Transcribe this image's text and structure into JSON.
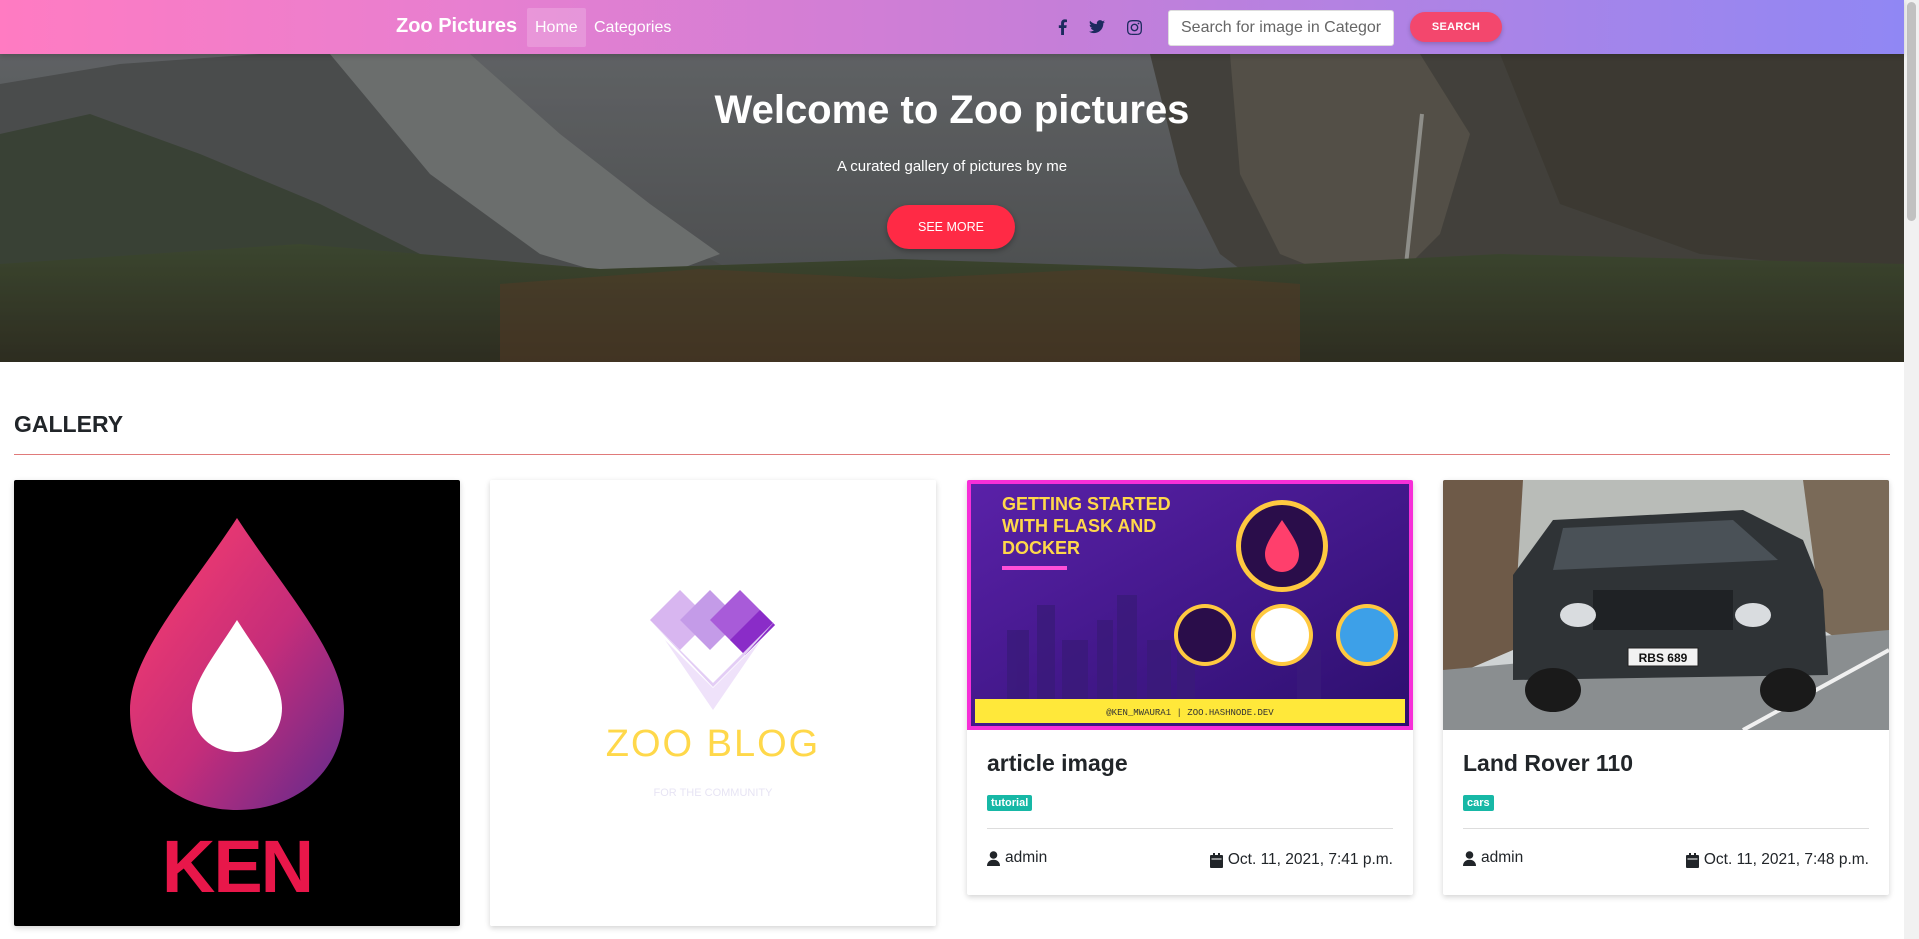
{
  "navbar": {
    "brand": "Zoo Pictures",
    "links": [
      {
        "label": "Home",
        "active": true
      },
      {
        "label": "Categories",
        "active": false
      }
    ],
    "social_icons": [
      "facebook-icon",
      "twitter-icon",
      "instagram-icon"
    ],
    "search": {
      "placeholder": "Search for image in Category",
      "button_label": "SEARCH"
    }
  },
  "hero": {
    "title": "Welcome to Zoo pictures",
    "subtitle": "A curated gallery of pictures by me",
    "button_label": "SEE MORE"
  },
  "gallery": {
    "heading": "GALLERY",
    "cards": [
      {
        "title": "",
        "tag": "",
        "author": "",
        "date": ""
      },
      {
        "title": "",
        "tag": "",
        "author": "",
        "date": ""
      },
      {
        "title": "article image",
        "tag": "tutorial",
        "author": "admin",
        "date": "Oct. 11, 2021, 7:41 p.m."
      },
      {
        "title": "Land Rover 110",
        "tag": "cars",
        "author": "admin",
        "date": "Oct. 11, 2021, 7:48 p.m."
      }
    ]
  },
  "card_images": {
    "ken_logo_text": "KEN",
    "zoo_blog_text": "ZOO BLOG",
    "zoo_blog_tagline": "FOR THE COMMUNITY",
    "article_banner_title_lines": [
      "GETTING STARTED",
      "WITH FLASK AND",
      "DOCKER"
    ],
    "article_banner_footer": "@KEN_MWAURA1 | ZOO.HASHNODE.DEV",
    "plate_text": "RBS 689"
  },
  "colors": {
    "navbar_gradient_start": "#ff7bc2",
    "navbar_gradient_end": "#9087f4",
    "accent_red": "#ff2a45",
    "search_button": "#f3476d",
    "tag_teal": "#17b8a6",
    "gallery_rule": "#e07a7a"
  }
}
